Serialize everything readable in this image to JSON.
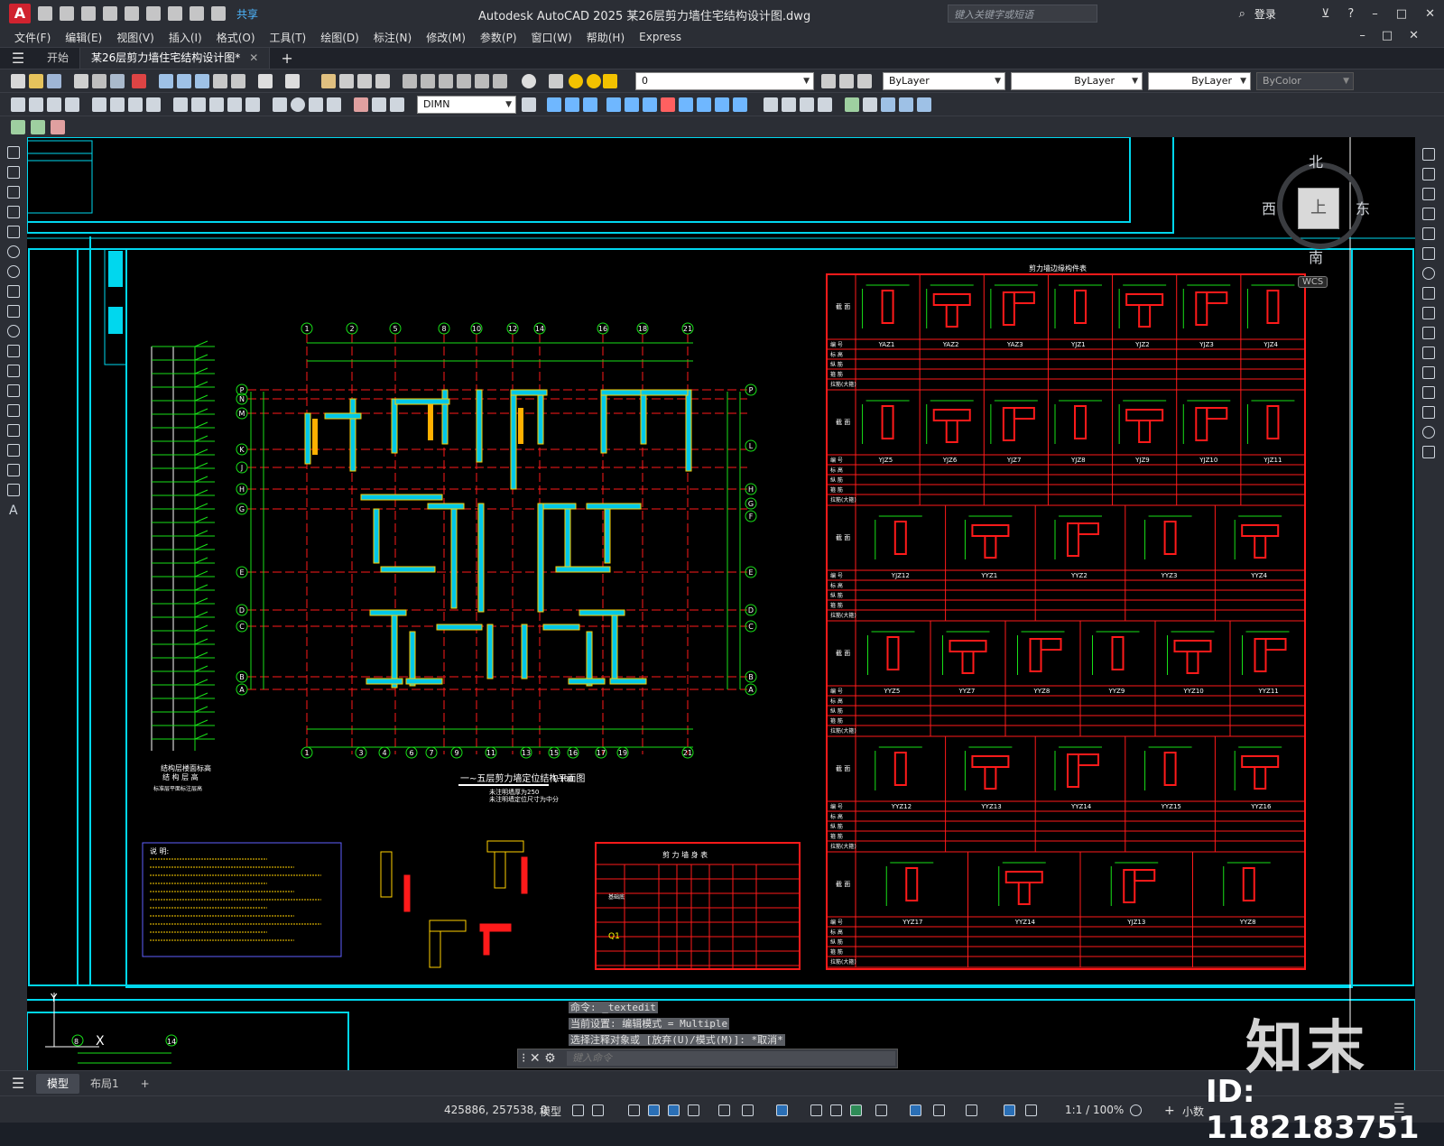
{
  "titlebar": {
    "app_logo": "A",
    "share": "共享",
    "title": "Autodesk AutoCAD 2025    某26层剪力墙住宅结构设计图.dwg",
    "search_placeholder": "键入关键字或短语",
    "login": "登录"
  },
  "menubar": {
    "items": [
      "文件(F)",
      "编辑(E)",
      "视图(V)",
      "插入(I)",
      "格式(O)",
      "工具(T)",
      "绘图(D)",
      "标注(N)",
      "修改(M)",
      "参数(P)",
      "窗口(W)",
      "帮助(H)",
      "Express"
    ]
  },
  "tabs": {
    "start": "开始",
    "drawing": "某26层剪力墙住宅结构设计图*"
  },
  "toolbar": {
    "layer": "0",
    "color": "ByLayer",
    "linetype": "ByLayer",
    "lineweight": "ByLayer",
    "plotstyle": "ByColor",
    "dimstyle": "DIMN"
  },
  "viewcube": {
    "north": "北",
    "south": "南",
    "east": "东",
    "west": "西",
    "face": "上",
    "wcs": "WCS"
  },
  "drawing": {
    "plan_title": "一~五层剪力墙定位结构平面图",
    "plan_scale": "1:100",
    "plan_note1": "未注明墙厚为250",
    "plan_note2": "未注明墙定位尺寸为中分",
    "table_title": "剪力墙边缘构件表",
    "small_table_title": "剪 力 墙 身 表",
    "notes_title": "说 明:",
    "schedule_title": "结构层楼面标高",
    "schedule_sub": "结 构 层 高",
    "schedule_note": "标准层平面标注层高",
    "row_labels": [
      "截 面",
      "编 号",
      "标 高",
      "纵 筋",
      "箍 筋",
      "拉筋(大箍)"
    ],
    "wall_id": "Q1",
    "wall_label": "基础底",
    "axis_top": [
      "1",
      "2",
      "5",
      "8",
      "10",
      "12",
      "14",
      "16",
      "18",
      "21"
    ],
    "axis_bottom": [
      "1",
      "3",
      "4",
      "6",
      "7",
      "9",
      "11",
      "13",
      "15",
      "16",
      "17",
      "19",
      "21"
    ],
    "axis_left": [
      "P",
      "N",
      "M",
      "K",
      "J",
      "H",
      "G",
      "E",
      "D",
      "C",
      "B",
      "A"
    ],
    "axis_right": [
      "P",
      "L",
      "H",
      "G",
      "F",
      "E",
      "D",
      "C",
      "B",
      "A"
    ],
    "mini_axes": [
      "8",
      "14"
    ],
    "components_row1": [
      "YAZ1",
      "YAZ2",
      "YAZ3",
      "YJZ1",
      "YJZ2",
      "YJZ3",
      "YJZ4"
    ],
    "components_row2": [
      "YJZ5",
      "YJZ6",
      "YJZ7",
      "YJZ8",
      "YJZ9",
      "YJZ10",
      "YJZ11"
    ],
    "components_row3": [
      "YJZ12",
      "YYZ1",
      "YYZ2",
      "YYZ3",
      "YYZ4"
    ],
    "components_row4": [
      "YYZ5",
      "YYZ7",
      "YYZ8",
      "YYZ9",
      "YYZ10",
      "YYZ11"
    ],
    "components_row5": [
      "YYZ12",
      "YYZ13",
      "YYZ14",
      "YYZ15",
      "YYZ16"
    ],
    "components_row6": [
      "YYZ17",
      "YYZ14",
      "YJZ13",
      "YYZ8"
    ]
  },
  "commandline": {
    "line1": "命令: _textedit",
    "line2": "当前设置: 编辑模式 = Multiple",
    "line3": "选择注释对象或 [放弃(U)/模式(M)]: *取消*",
    "placeholder": "键入命令"
  },
  "layouts": {
    "model": "模型",
    "layout1": "布局1"
  },
  "statusbar": {
    "coords": "425886, 257538, 0",
    "model": "模型",
    "scale": "1:1 / 100%",
    "units": "小数"
  },
  "watermark": {
    "logo": "知末",
    "id": "ID: 1182183751"
  },
  "colors": {
    "red": "#ff1a1a",
    "green": "#18e018",
    "cyan": "#00e5ff",
    "yellow": "#ffd000",
    "white": "#ffffff",
    "magenta": "#ff3cff"
  }
}
